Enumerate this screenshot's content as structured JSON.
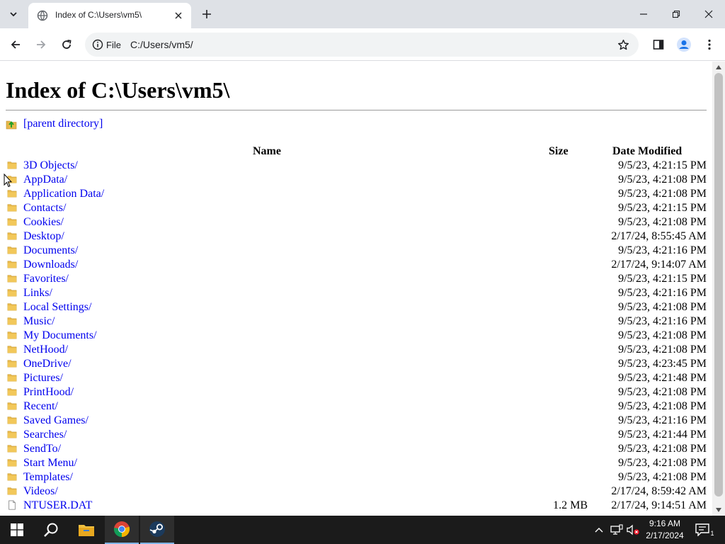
{
  "browser": {
    "tab_title": "Index of C:\\Users\\vm5\\",
    "scheme_chip": "File",
    "url": "C:/Users/vm5/"
  },
  "page": {
    "heading": "Index of C:\\Users\\vm5\\",
    "parent_link": "[parent directory]",
    "columns": {
      "name": "Name",
      "size": "Size",
      "date": "Date Modified"
    },
    "entries": [
      {
        "name": "3D Objects/",
        "size": "",
        "date": "9/5/23, 4:21:15 PM",
        "type": "folder"
      },
      {
        "name": "AppData/",
        "size": "",
        "date": "9/5/23, 4:21:08 PM",
        "type": "folder"
      },
      {
        "name": "Application Data/",
        "size": "",
        "date": "9/5/23, 4:21:08 PM",
        "type": "folder"
      },
      {
        "name": "Contacts/",
        "size": "",
        "date": "9/5/23, 4:21:15 PM",
        "type": "folder"
      },
      {
        "name": "Cookies/",
        "size": "",
        "date": "9/5/23, 4:21:08 PM",
        "type": "folder"
      },
      {
        "name": "Desktop/",
        "size": "",
        "date": "2/17/24, 8:55:45 AM",
        "type": "folder"
      },
      {
        "name": "Documents/",
        "size": "",
        "date": "9/5/23, 4:21:16 PM",
        "type": "folder"
      },
      {
        "name": "Downloads/",
        "size": "",
        "date": "2/17/24, 9:14:07 AM",
        "type": "folder"
      },
      {
        "name": "Favorites/",
        "size": "",
        "date": "9/5/23, 4:21:15 PM",
        "type": "folder"
      },
      {
        "name": "Links/",
        "size": "",
        "date": "9/5/23, 4:21:16 PM",
        "type": "folder"
      },
      {
        "name": "Local Settings/",
        "size": "",
        "date": "9/5/23, 4:21:08 PM",
        "type": "folder"
      },
      {
        "name": "Music/",
        "size": "",
        "date": "9/5/23, 4:21:16 PM",
        "type": "folder"
      },
      {
        "name": "My Documents/",
        "size": "",
        "date": "9/5/23, 4:21:08 PM",
        "type": "folder"
      },
      {
        "name": "NetHood/",
        "size": "",
        "date": "9/5/23, 4:21:08 PM",
        "type": "folder"
      },
      {
        "name": "OneDrive/",
        "size": "",
        "date": "9/5/23, 4:23:45 PM",
        "type": "folder"
      },
      {
        "name": "Pictures/",
        "size": "",
        "date": "9/5/23, 4:21:48 PM",
        "type": "folder"
      },
      {
        "name": "PrintHood/",
        "size": "",
        "date": "9/5/23, 4:21:08 PM",
        "type": "folder"
      },
      {
        "name": "Recent/",
        "size": "",
        "date": "9/5/23, 4:21:08 PM",
        "type": "folder"
      },
      {
        "name": "Saved Games/",
        "size": "",
        "date": "9/5/23, 4:21:16 PM",
        "type": "folder"
      },
      {
        "name": "Searches/",
        "size": "",
        "date": "9/5/23, 4:21:44 PM",
        "type": "folder"
      },
      {
        "name": "SendTo/",
        "size": "",
        "date": "9/5/23, 4:21:08 PM",
        "type": "folder"
      },
      {
        "name": "Start Menu/",
        "size": "",
        "date": "9/5/23, 4:21:08 PM",
        "type": "folder"
      },
      {
        "name": "Templates/",
        "size": "",
        "date": "9/5/23, 4:21:08 PM",
        "type": "folder"
      },
      {
        "name": "Videos/",
        "size": "",
        "date": "2/17/24, 8:59:42 AM",
        "type": "folder"
      },
      {
        "name": "NTUSER.DAT",
        "size": "1.2 MB",
        "date": "2/17/24, 9:14:51 AM",
        "type": "file"
      }
    ]
  },
  "taskbar": {
    "time": "9:16 AM",
    "date": "2/17/2024",
    "notification_count": "1"
  },
  "colors": {
    "link": "#0000ee",
    "tabstrip": "#dee1e6",
    "taskbar": "#1b1b1b",
    "folder": "#e8b84a"
  }
}
